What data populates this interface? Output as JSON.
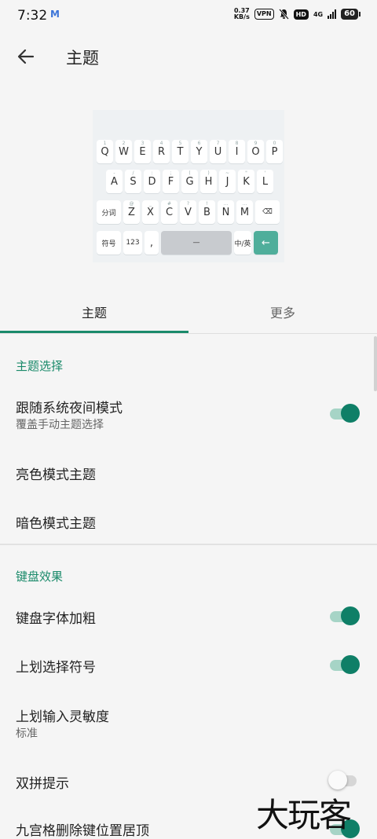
{
  "status_bar": {
    "time": "7:32",
    "mail_icon": "M",
    "speed_value": "0.37",
    "speed_unit": "KB/s",
    "vpn": "VPN",
    "hd": "HD",
    "network": "4G",
    "battery": "60"
  },
  "header": {
    "title": "主题",
    "back_icon": "arrow-left"
  },
  "keyboard_preview": {
    "row1": [
      {
        "k": "Q",
        "s": "1"
      },
      {
        "k": "W",
        "s": "2"
      },
      {
        "k": "E",
        "s": "3"
      },
      {
        "k": "R",
        "s": "4"
      },
      {
        "k": "T",
        "s": "5"
      },
      {
        "k": "Y",
        "s": "6"
      },
      {
        "k": "U",
        "s": "7"
      },
      {
        "k": "I",
        "s": "8"
      },
      {
        "k": "O",
        "s": "9"
      },
      {
        "k": "P",
        "s": "0"
      }
    ],
    "row2": [
      {
        "k": "A",
        "s": "-"
      },
      {
        "k": "S",
        "s": "/"
      },
      {
        "k": "D",
        "s": ":"
      },
      {
        "k": "F",
        "s": ";"
      },
      {
        "k": "G",
        "s": "("
      },
      {
        "k": "H",
        "s": ")"
      },
      {
        "k": "J",
        "s": "~"
      },
      {
        "k": "K",
        "s": "\""
      },
      {
        "k": "L",
        "s": "'"
      }
    ],
    "row3": [
      {
        "k": "分词",
        "s": ""
      },
      {
        "k": "Z",
        "s": "@"
      },
      {
        "k": "X",
        "s": "_"
      },
      {
        "k": "C",
        "s": "#"
      },
      {
        "k": "V",
        "s": "?"
      },
      {
        "k": "B",
        "s": "!"
      },
      {
        "k": "N",
        "s": "…"
      },
      {
        "k": "M",
        "s": "…"
      },
      {
        "k": "⌫",
        "s": ""
      }
    ],
    "row4": [
      {
        "k": "符号",
        "s": ""
      },
      {
        "k": "123",
        "s": ""
      },
      {
        "k": ",",
        "s": ""
      },
      {
        "k": "—",
        "s": ""
      },
      {
        "k": "中/英",
        "s": ""
      },
      {
        "k": "←",
        "s": ""
      }
    ]
  },
  "tabs": [
    {
      "label": "主题"
    },
    {
      "label": "更多"
    }
  ],
  "sections": {
    "theme_select": "主题选择",
    "keyboard_effect": "键盘效果"
  },
  "items": {
    "follow_night": {
      "label": "跟随系统夜间模式",
      "sub": "覆盖手动主题选择",
      "on": true
    },
    "light_theme": {
      "label": "亮色模式主题"
    },
    "dark_theme": {
      "label": "暗色模式主题"
    },
    "bold_font": {
      "label": "键盘字体加粗",
      "on": true
    },
    "swipe_symbol": {
      "label": "上划选择符号",
      "on": true
    },
    "swipe_sensitivity": {
      "label": "上划输入灵敏度",
      "sub": "标准"
    },
    "shuangpin_hint": {
      "label": "双拼提示",
      "on": false
    },
    "nine_grid_delete": {
      "label": "九宫格删除键位置居顶",
      "on": true
    }
  },
  "watermark": "大玩客",
  "colors": {
    "accent": "#1a8a6a",
    "toggle_on": "#0f7f67",
    "enter_key": "#4fae9b"
  }
}
